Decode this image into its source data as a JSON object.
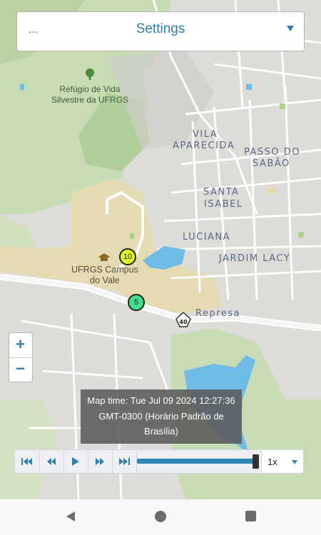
{
  "settings": {
    "menu_label": "...",
    "title": "Settings"
  },
  "map": {
    "neighborhoods": [
      "Vila",
      "Aparecida",
      "Passo do",
      "Sabão",
      "Santa",
      "Isabel",
      "Luciana",
      "Jardim Lacy",
      "Represa"
    ],
    "poi_line1": "Refúgio de Vida",
    "poi_line2": "Silvestre da UFRGS",
    "campus_line1": "UFRGS Campus",
    "campus_line2": "do Vale",
    "route_shield": "40",
    "markers": [
      {
        "count": "10",
        "color": "#dffb28"
      },
      {
        "count": "5",
        "color": "#41de8c"
      }
    ]
  },
  "zoom": {
    "in_label": "+",
    "out_label": "−"
  },
  "tooltip": {
    "line1": "Map time: Tue Jul 09 2024 12:27:36",
    "line2": "GMT-0300 (Horário Padrão de",
    "line3": "Brasília)"
  },
  "player": {
    "speed": "1x",
    "progress_fraction": 1.0
  },
  "colors": {
    "accent": "#2e7fb0",
    "water": "#6dbbe6",
    "park": "#c3dab0",
    "campus": "#e3d9ae"
  }
}
